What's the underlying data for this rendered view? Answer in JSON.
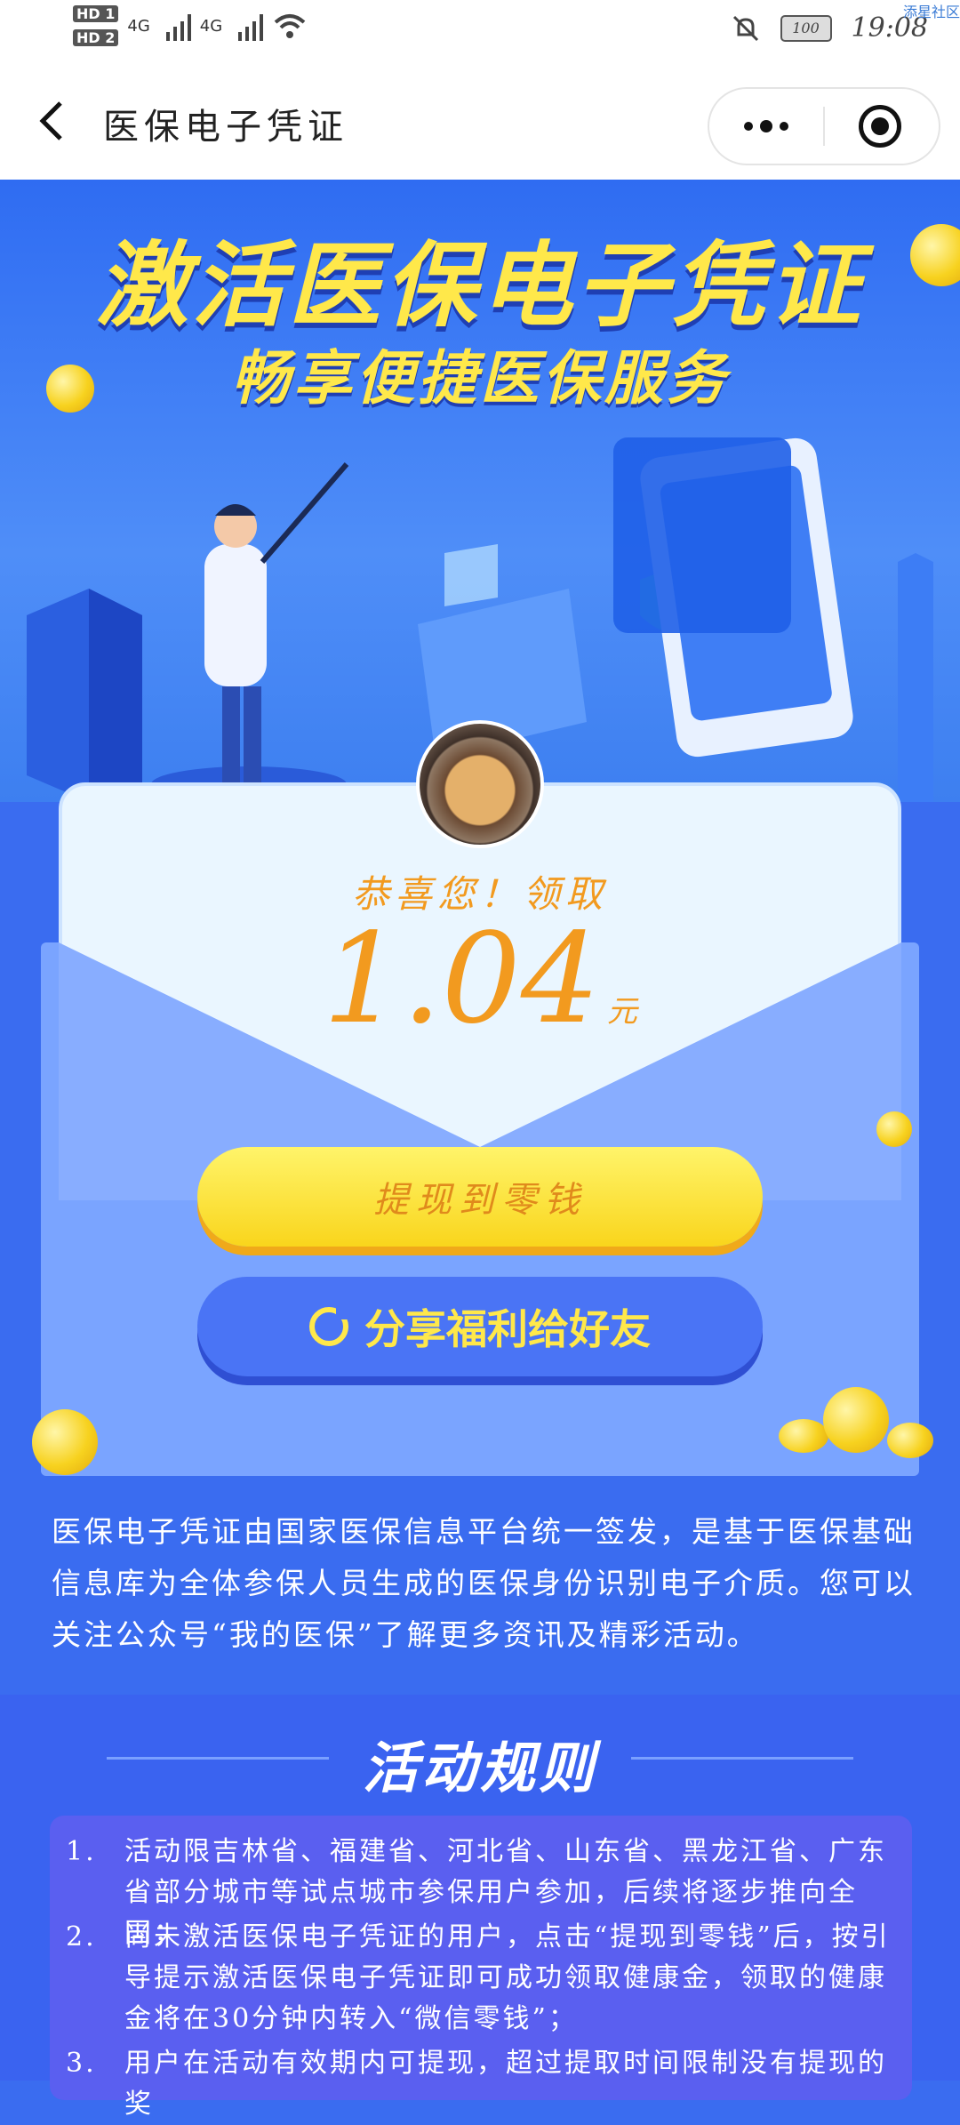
{
  "status_bar": {
    "hd1": "HD 1",
    "hd2": "HD 2",
    "net1": "4G",
    "net2": "4G",
    "battery": "100",
    "time": "19:08",
    "corner": "添星社区"
  },
  "header": {
    "title": "医保电子凭证",
    "more_icon": "more-dots-icon",
    "close_icon": "target-circle-icon"
  },
  "banner": {
    "headline": "激活医保电子凭证",
    "subheadline": "畅享便捷医保服务"
  },
  "reward": {
    "congrats": "恭喜您！领取",
    "amount": "1.04",
    "unit": "元",
    "withdraw_label": "提现到零钱",
    "share_label": "分享福利给好友"
  },
  "description": "医保电子凭证由国家医保信息平台统一签发，是基于医保基础信息库为全体参保人员生成的医保身份识别电子介质。您可以关注公众号“我的医保”了解更多资讯及精彩活动。",
  "rules": {
    "title": "活动规则",
    "items": [
      {
        "num": "1.",
        "text": "活动限吉林省、福建省、河北省、山东省、黑龙江省、广东省部分城市等试点城市参保用户参加，后续将逐步推向全国；"
      },
      {
        "num": "2.",
        "text": "尚未激活医保电子凭证的用户，点击“提现到零钱”后，按引导提示激活医保电子凭证即可成功领取健康金，领取的健康金将在30分钟内转入“微信零钱”；"
      },
      {
        "num": "3.",
        "text": "用户在活动有效期内可提现，超过提取时间限制没有提现的奖"
      }
    ]
  },
  "colors": {
    "brand_blue": "#3a6cf0",
    "gold": "#ffe84a",
    "orange_text": "#f29a1f"
  }
}
